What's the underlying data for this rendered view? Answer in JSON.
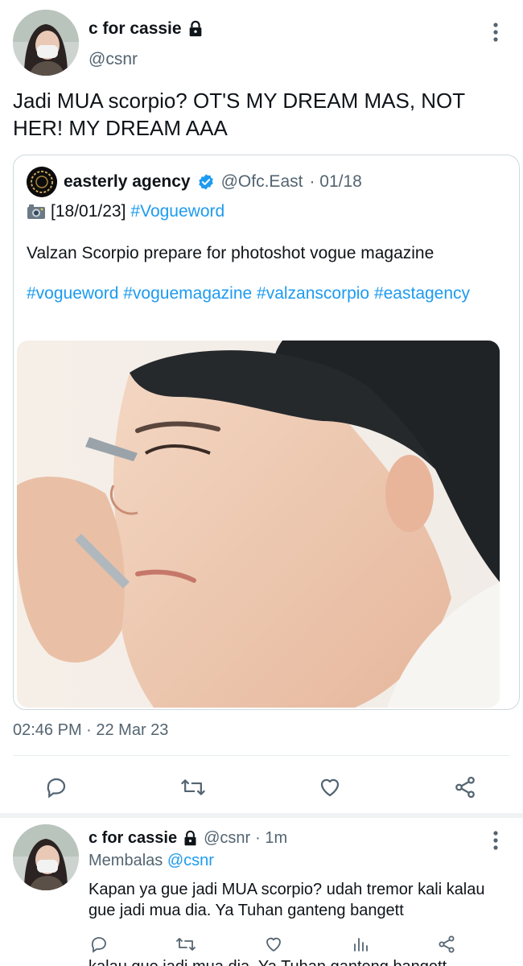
{
  "main_tweet": {
    "display_name": "c for cassie",
    "handle": "@csnr",
    "text": "Jadi MUA scorpio? OT'S MY DREAM MAS, NOT HER! MY DREAM AAA",
    "timestamp": "02:46 PM · 22 Mar 23",
    "icons": {
      "lock": "lock-icon",
      "more": "more-vertical-icon"
    }
  },
  "quoted_tweet": {
    "display_name": "easterly agency",
    "handle": "@Ofc.East",
    "date": "· 01/18",
    "line1_date": "[18/01/23]",
    "line1_tag": "#Vogueword",
    "body": "Valzan Scorpio prepare for photoshot vogue magazine",
    "tags": "#vogueword #voguemagazine #valzanscorpio #eastagency",
    "icons": {
      "verified": "verified-badge-icon",
      "camera": "camera-flash-emoji"
    }
  },
  "actions": [
    "reply-icon",
    "retweet-icon",
    "like-icon",
    "share-icon"
  ],
  "reply_tweet": {
    "display_name": "c for cassie",
    "handle": "@csnr",
    "time": "· 1m",
    "replying_label": "Membalas",
    "replying_to": "@csnr",
    "text": "Kapan ya gue jadi MUA scorpio? udah tremor kali kalau gue jadi mua dia. Ya Tuhan ganteng bangett",
    "cutoff_text": "kalau gue jadi mua dia. Ya Tuhan ganteng bangett",
    "actions": [
      "reply-icon",
      "retweet-icon",
      "like-icon",
      "analytics-icon",
      "share-icon"
    ]
  },
  "colors": {
    "link": "#1d9bf0",
    "secondary": "#536471",
    "text": "#0f1419",
    "border": "#cfd9de"
  }
}
